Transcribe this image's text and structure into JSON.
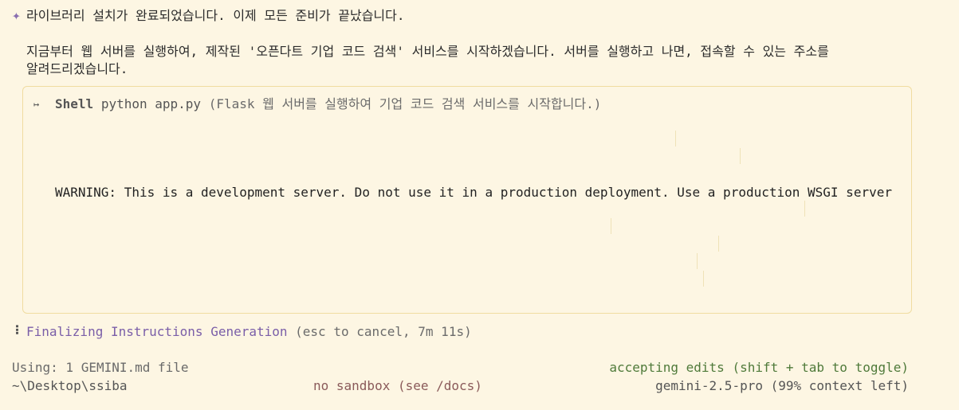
{
  "message": {
    "sparkle_icon": "✦",
    "line1": "라이브러리 설치가 완료되었습니다. 이제 모든 준비가 끝났습니다.",
    "paragraph": "지금부터 웹 서버를 실행하여, 제작된 '오픈다트 기업 코드 검색' 서비스를 시작하겠습니다. 서버를 실행하고 나면, 접속할 수 있는 주소를 알려드리겠습니다."
  },
  "shell": {
    "icon": "↦",
    "tool_name": "Shell",
    "command": "python app.py",
    "description": "(Flask 웹 서버를 실행하여 기업 코드 검색 서비스를 시작합니다.)",
    "output": "WARNING: This is a development server. Do not use it in a production deployment. Use a production WSGI server"
  },
  "status": {
    "spinner": "⠇",
    "text": "Finalizing Instructions Generation",
    "hint": "(esc to cancel, 7m 11s)"
  },
  "footer": {
    "context_files": "Using: 1 GEMINI.md file",
    "edit_mode": "accepting edits (shift + tab to toggle)",
    "cwd": "~\\Desktop\\ssiba",
    "sandbox": "no sandbox (see /docs)",
    "model": "gemini-2.5-pro (99% context left)"
  }
}
